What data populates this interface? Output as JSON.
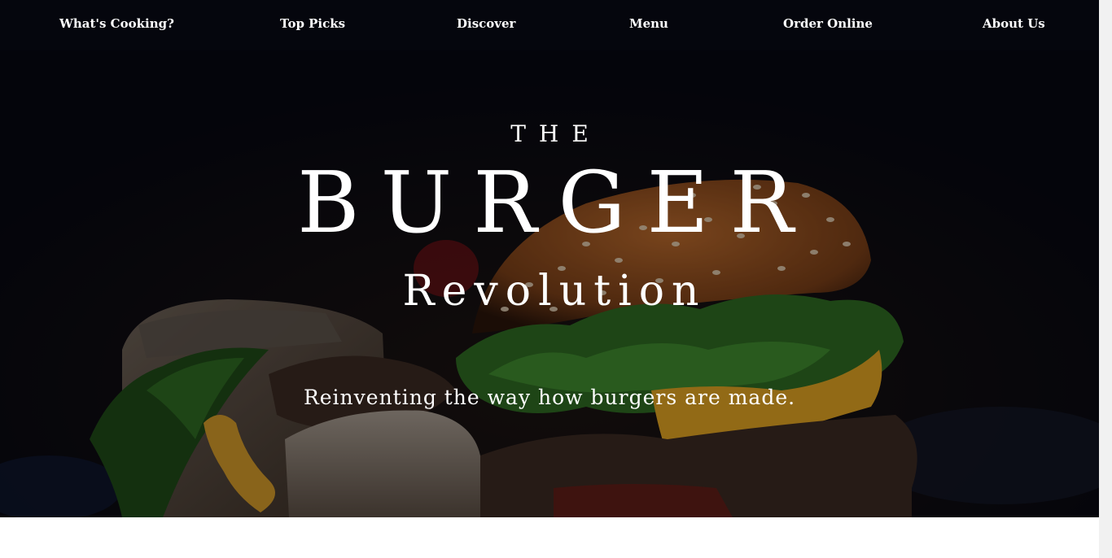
{
  "nav": {
    "items": [
      {
        "label": "What's Cooking?"
      },
      {
        "label": "Top Picks"
      },
      {
        "label": "Discover"
      },
      {
        "label": "Menu"
      },
      {
        "label": "Order Online"
      },
      {
        "label": "About Us"
      }
    ]
  },
  "hero": {
    "pre_title": "THE",
    "title": "BURGER",
    "subtitle": "Revolution",
    "tagline": "Reinventing the way how burgers are made."
  },
  "colors": {
    "background": "#070812",
    "text": "#ffffff",
    "bun": "#b8692c",
    "lettuce": "#2f6b23",
    "cheese": "#e0a322",
    "patty": "#3b2a22"
  }
}
